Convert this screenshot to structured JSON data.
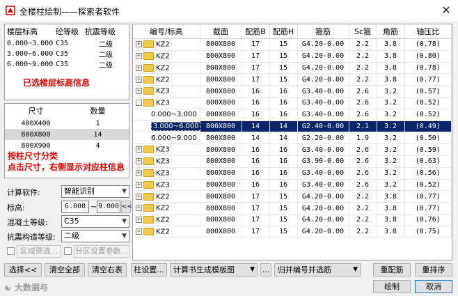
{
  "window": {
    "title": "全楼柱绘制——探索者软件",
    "close_symbol": "✕"
  },
  "levels": {
    "headers": [
      "楼层标高",
      "砼等级",
      "抗震等级"
    ],
    "rows": [
      [
        "0.000~3.000",
        "C35",
        "二级"
      ],
      [
        "3.000~6.000",
        "C35",
        "二级"
      ],
      [
        "6.000~9.000",
        "C35",
        "二级"
      ]
    ],
    "note": "已选楼层标高信息"
  },
  "sizes": {
    "headers": [
      "尺寸",
      "数量"
    ],
    "rows": [
      [
        "400X400",
        "1"
      ],
      [
        "800X800",
        "14"
      ],
      [
        "800X900",
        "4"
      ]
    ],
    "selected_index": 1,
    "note1": "按柱尺寸分类",
    "note2": "点击尺寸，右侧显示对应柱信息"
  },
  "form": {
    "calc_label": "计算软件:",
    "calc_value": "智能识别",
    "elev_label": "标高:",
    "elev_from": "6.000",
    "elev_tilde": "~",
    "elev_to": "9.000",
    "elev_btn": "<<",
    "concrete_label": "混凝土等级:",
    "concrete_value": "C35",
    "seismic_label": "抗震构造等级:",
    "seismic_value": "二级",
    "region_btn": "区域筛选...",
    "zone_btn": "分区设置参数..."
  },
  "grid": {
    "headers": [
      "编号/标高",
      "截面",
      "配筋B",
      "配筋H",
      "箍筋",
      "Sc箍",
      "角筋",
      "轴压比"
    ],
    "rows": [
      {
        "type": "group",
        "exp": "+",
        "name": "KZ2",
        "sec": "800X800",
        "b": "17",
        "h": "15",
        "st": "G4.20-0.00",
        "sc": "2.2",
        "cn": "3.8",
        "ax": "(0.78)"
      },
      {
        "type": "group",
        "exp": "+",
        "name": "KZ2",
        "sec": "800X800",
        "b": "17",
        "h": "15",
        "st": "G4.20-0.00",
        "sc": "2.2",
        "cn": "3.8",
        "ax": "(0.80)"
      },
      {
        "type": "group",
        "exp": "+",
        "name": "KZ2",
        "sec": "800X800",
        "b": "17",
        "h": "15",
        "st": "G4.20-0.00",
        "sc": "2.2",
        "cn": "3.8",
        "ax": "(0.78)"
      },
      {
        "type": "group",
        "exp": "+",
        "name": "KZ2",
        "sec": "800X800",
        "b": "17",
        "h": "15",
        "st": "G4.20-0.00",
        "sc": "2.2",
        "cn": "3.8",
        "ax": "(0.77)"
      },
      {
        "type": "group",
        "exp": "+",
        "name": "KZ3",
        "sec": "800X800",
        "b": "16",
        "h": "16",
        "st": "G3.40-0.00",
        "sc": "2.6",
        "cn": "3.2",
        "ax": "(0.57)"
      },
      {
        "type": "group",
        "exp": "-",
        "name": "KZ3",
        "sec": "800X800",
        "b": "16",
        "h": "16",
        "st": "G3.40-0.00",
        "sc": "2.6",
        "cn": "3.2",
        "ax": "(0.52)"
      },
      {
        "type": "level",
        "name": "0.000~3.000",
        "sec": "800X800",
        "b": "16",
        "h": "16",
        "st": "G3.40-0.00",
        "sc": "2.6",
        "cn": "3.2",
        "ax": "(0.52)"
      },
      {
        "type": "level",
        "sel": true,
        "name": "3.000~6.000",
        "sec": "800X800",
        "b": "14",
        "h": "14",
        "st": "G2.40-0.00",
        "sc": "2.1",
        "cn": "3.2",
        "ax": "(0.49)"
      },
      {
        "type": "level",
        "name": "6.000~9.000",
        "sec": "800X800",
        "b": "14",
        "h": "14",
        "st": "G2.20-0.00",
        "sc": "1.9",
        "cn": "3.2",
        "ax": "(0.50)"
      },
      {
        "type": "group",
        "exp": "+",
        "name": "KZ3",
        "sec": "800X800",
        "b": "16",
        "h": "16",
        "st": "G3.40-0.00",
        "sc": "2.6",
        "cn": "3.2",
        "ax": "(0.59)"
      },
      {
        "type": "group",
        "exp": "+",
        "name": "KZ3",
        "sec": "800X800",
        "b": "16",
        "h": "16",
        "st": "G3.90-0.00",
        "sc": "2.6",
        "cn": "3.2",
        "ax": "(0.63)"
      },
      {
        "type": "group",
        "exp": "+",
        "name": "KZ3",
        "sec": "800X800",
        "b": "16",
        "h": "16",
        "st": "G3.40-0.00",
        "sc": "2.6",
        "cn": "3.2",
        "ax": "(0.56)"
      },
      {
        "type": "group",
        "exp": "+",
        "name": "KZ3",
        "sec": "800X800",
        "b": "16",
        "h": "16",
        "st": "G3.40-0.00",
        "sc": "2.6",
        "cn": "3.2",
        "ax": "(0.52)"
      },
      {
        "type": "group",
        "exp": "+",
        "name": "KZ2",
        "sec": "800X800",
        "b": "17",
        "h": "15",
        "st": "G4.20-0.00",
        "sc": "2.2",
        "cn": "3.8",
        "ax": "(0.77)"
      },
      {
        "type": "group",
        "exp": "+",
        "name": "KZ2",
        "sec": "800X800",
        "b": "17",
        "h": "15",
        "st": "G4.20-0.00",
        "sc": "2.2",
        "cn": "3.8",
        "ax": "(0.77)"
      },
      {
        "type": "group",
        "exp": "+",
        "name": "KZ2",
        "sec": "800X800",
        "b": "17",
        "h": "15",
        "st": "G4.20-0.00",
        "sc": "2.2",
        "cn": "3.8",
        "ax": "(0.76)"
      },
      {
        "type": "group",
        "exp": "+",
        "name": "KZ2",
        "sec": "800X800",
        "b": "17",
        "h": "15",
        "st": "G4.20-0.00",
        "sc": "2.2",
        "cn": "3.8",
        "ax": "(0.75)"
      }
    ]
  },
  "buttons": {
    "select": "选择<<",
    "clear_all": "清空全部",
    "clear_right": "清空右表",
    "col_settings": "柱设置...",
    "template_combo": "计算书生成模板图",
    "ellipsis": "...",
    "merge_combo": "归并编号并选筋",
    "rebar": "重配筋",
    "resort": "重排序",
    "draw": "绘制",
    "cancel": "取消"
  },
  "watermark": "大数据与"
}
